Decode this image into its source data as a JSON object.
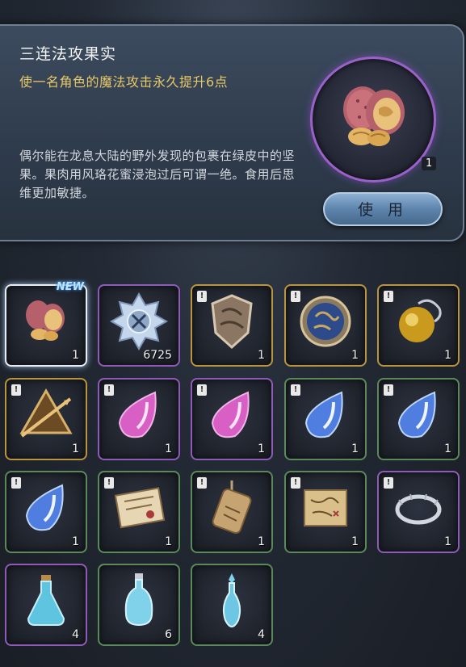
{
  "detail": {
    "title": "三连法攻果实",
    "effect": "使一名角色的魔法攻击永久提升6点",
    "description": "偶尔能在龙息大陆的野外发现的包裹在绿皮中的坚果。果肉用风珞花蜜浸泡过后可谓一绝。食用后思维更加敏捷。",
    "owned_count": "1",
    "use_label": "使 用",
    "rarity_color": "#9a62c9"
  },
  "inventory": {
    "new_label": "NEW",
    "badge_glyph": "!",
    "items": [
      {
        "icon": "walnut-icon",
        "count": "1"
      },
      {
        "icon": "crystal-medal-icon",
        "count": "6725"
      },
      {
        "icon": "bronze-shield-emblem-icon",
        "count": "1"
      },
      {
        "icon": "blue-coin-icon",
        "count": "1"
      },
      {
        "icon": "gold-orb-icon",
        "count": "1"
      },
      {
        "icon": "gold-arrow-emblem-icon",
        "count": "1"
      },
      {
        "icon": "pink-gem-icon",
        "count": "1"
      },
      {
        "icon": "pink-gem-icon",
        "count": "1"
      },
      {
        "icon": "blue-gem-icon",
        "count": "1"
      },
      {
        "icon": "blue-gem-icon",
        "count": "1"
      },
      {
        "icon": "blue-gem-icon",
        "count": "1"
      },
      {
        "icon": "letter-scroll-icon",
        "count": "1"
      },
      {
        "icon": "wooden-tag-icon",
        "count": "1"
      },
      {
        "icon": "treasure-map-icon",
        "count": "1"
      },
      {
        "icon": "silver-ring-icon",
        "count": "1"
      },
      {
        "icon": "blue-potion-flask-icon",
        "count": "4"
      },
      {
        "icon": "blue-potion-bottle-icon",
        "count": "6"
      },
      {
        "icon": "blue-potion-vial-icon",
        "count": "4"
      }
    ]
  }
}
